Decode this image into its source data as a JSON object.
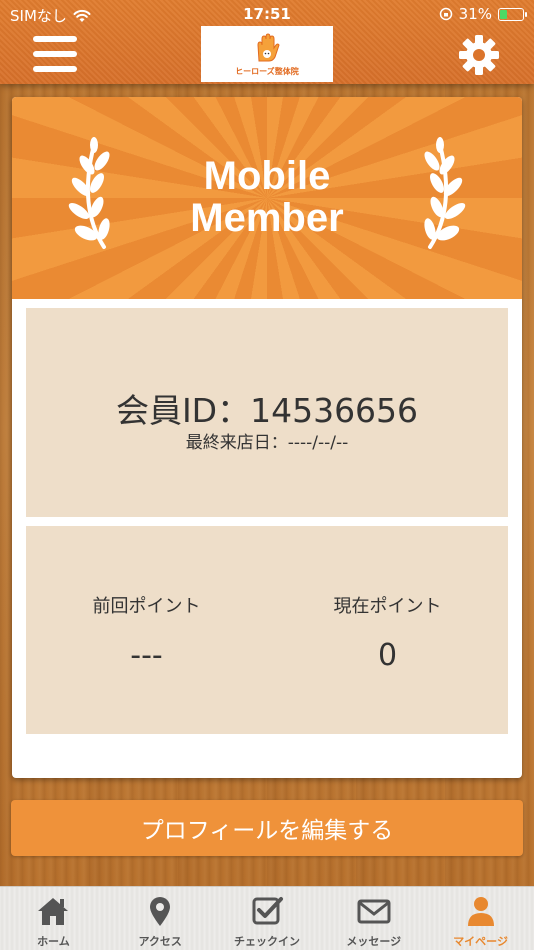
{
  "status_bar": {
    "carrier": "SIMなし",
    "time": "17:51",
    "battery": "31%",
    "battery_level": 0.31
  },
  "header": {
    "logo_text": "ヒーローズ整体院",
    "accent_color": "#e07c2e"
  },
  "banner": {
    "title_line1": "Mobile",
    "title_line2": "Member"
  },
  "member": {
    "id_text": "会員ID：14536656",
    "last_visit_text": "最終来店日：----/--/--"
  },
  "points": {
    "previous_label": "前回ポイント",
    "previous_value": "---",
    "current_label": "現在ポイント",
    "current_value": "0"
  },
  "edit_profile_label": "プロフィールを編集する",
  "tabs": [
    {
      "label": "ホーム",
      "icon": "home-icon"
    },
    {
      "label": "アクセス",
      "icon": "map-pin-icon"
    },
    {
      "label": "チェックイン",
      "icon": "checkin-icon"
    },
    {
      "label": "メッセージ",
      "icon": "mail-icon"
    },
    {
      "label": "マイページ",
      "icon": "user-icon",
      "active": true
    }
  ]
}
